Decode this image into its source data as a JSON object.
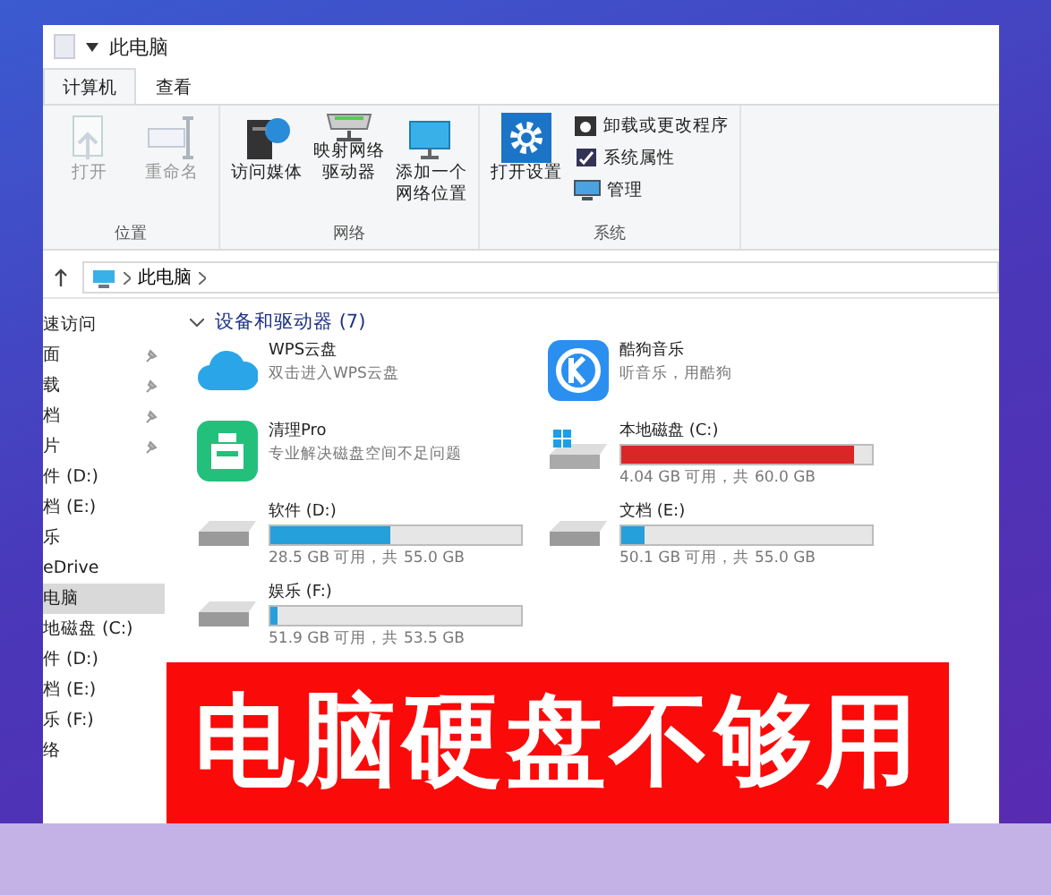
{
  "window": {
    "title": "此电脑"
  },
  "tabs": [
    {
      "label": "计算机",
      "selected": true
    },
    {
      "label": "查看",
      "selected": false
    }
  ],
  "ribbon": {
    "groups": [
      {
        "label": "位置",
        "buttons": [
          {
            "label": "打开",
            "kind": "open",
            "disabled": true
          },
          {
            "label": "重命名",
            "kind": "rename",
            "disabled": true
          }
        ]
      },
      {
        "label": "网络",
        "buttons": [
          {
            "label": "访问媒体",
            "kind": "media",
            "disabled": false
          },
          {
            "label": "映射网络驱动器",
            "kind": "netdrive",
            "disabled": false
          },
          {
            "label": "添加一个网络位置",
            "kind": "netloc",
            "disabled": false
          }
        ]
      },
      {
        "label": "系统",
        "buttons": [
          {
            "label": "打开设置",
            "kind": "settings",
            "disabled": false
          }
        ],
        "small": [
          {
            "label": "卸载或更改程序",
            "kind": "uninstall"
          },
          {
            "label": "系统属性",
            "kind": "props"
          },
          {
            "label": "管理",
            "kind": "manage"
          }
        ]
      }
    ]
  },
  "address": {
    "path": "此电脑"
  },
  "sidebar": {
    "items": [
      {
        "label": "速访问",
        "pinned": false,
        "selected": false
      },
      {
        "label": "面",
        "pinned": true,
        "selected": false
      },
      {
        "label": "载",
        "pinned": true,
        "selected": false
      },
      {
        "label": "档",
        "pinned": true,
        "selected": false
      },
      {
        "label": "片",
        "pinned": true,
        "selected": false
      },
      {
        "label": "件 (D:)",
        "pinned": false,
        "selected": false
      },
      {
        "label": "档 (E:)",
        "pinned": false,
        "selected": false
      },
      {
        "label": "乐",
        "pinned": false,
        "selected": false
      },
      {
        "label": "eDrive",
        "pinned": false,
        "selected": false
      },
      {
        "label": "电脑",
        "pinned": false,
        "selected": true
      },
      {
        "label": "地磁盘 (C:)",
        "pinned": false,
        "selected": false
      },
      {
        "label": "件 (D:)",
        "pinned": false,
        "selected": false
      },
      {
        "label": "档 (E:)",
        "pinned": false,
        "selected": false
      },
      {
        "label": "乐 (F:)",
        "pinned": false,
        "selected": false
      },
      {
        "label": "络",
        "pinned": false,
        "selected": false
      }
    ]
  },
  "section": {
    "title": "设备和驱动器 (7)"
  },
  "items": [
    {
      "kind": "cloud",
      "name": "WPS云盘",
      "subtitle": "双击进入WPS云盘"
    },
    {
      "kind": "player",
      "name": "酷狗音乐",
      "subtitle": "听音乐，用酷狗"
    },
    {
      "kind": "cleaner",
      "name": "清理Pro",
      "subtitle": "专业解决磁盘空间不足问题"
    },
    {
      "kind": "sysdrive",
      "name": "本地磁盘 (C:)",
      "level": 0.93,
      "color": "#da2626",
      "usage": "4.04 GB 可用，共 60.0 GB"
    },
    {
      "kind": "drive",
      "name": "软件 (D:)",
      "level": 0.48,
      "color": "#26a0da",
      "usage": "28.5 GB 可用，共 55.0 GB"
    },
    {
      "kind": "drive",
      "name": "文档 (E:)",
      "level": 0.09,
      "color": "#26a0da",
      "usage": "50.1 GB 可用，共 55.0 GB"
    },
    {
      "kind": "drive",
      "name": "娱乐 (F:)",
      "level": 0.03,
      "color": "#26a0da",
      "usage": "51.9 GB 可用，共 53.5 GB"
    }
  ],
  "banner": {
    "text": "电脑硬盘不够用"
  }
}
